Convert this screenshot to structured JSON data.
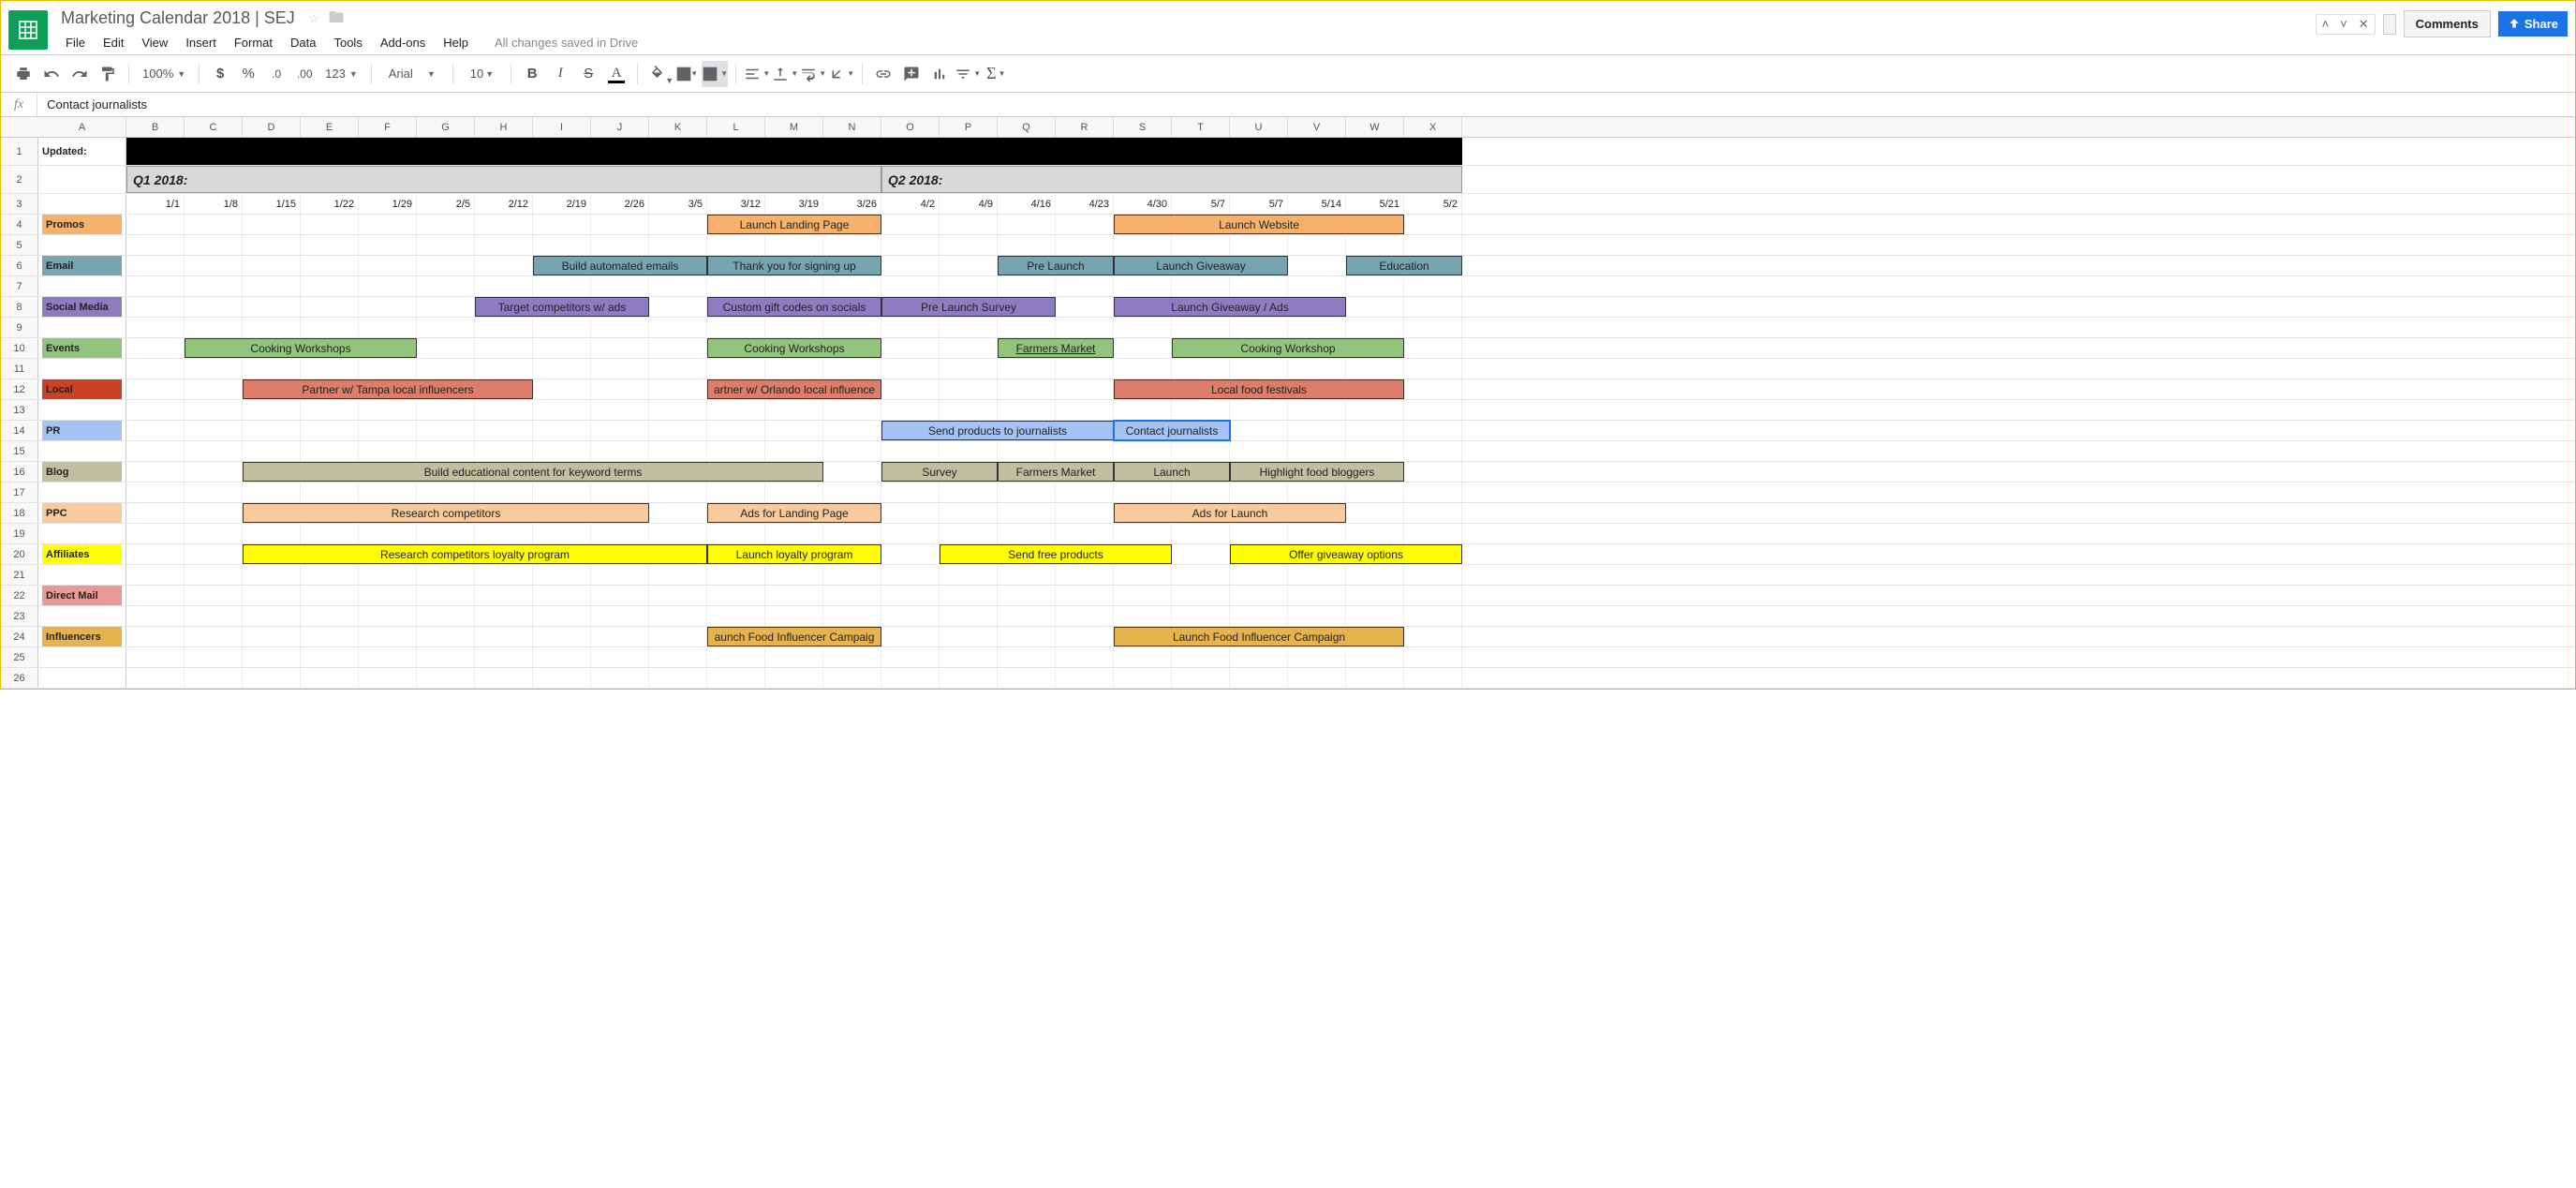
{
  "doc": {
    "title": "Marketing Calendar 2018 | SEJ",
    "save_status": "All changes saved in Drive"
  },
  "menu": {
    "file": "File",
    "edit": "Edit",
    "view": "View",
    "insert": "Insert",
    "format": "Format",
    "data": "Data",
    "tools": "Tools",
    "addons": "Add-ons",
    "help": "Help"
  },
  "buttons": {
    "comments": "Comments",
    "share": "Share"
  },
  "toolbar": {
    "zoom": "100%",
    "font": "Arial",
    "size": "10",
    "morefmt": "123"
  },
  "fx": {
    "value": "Contact journalists"
  },
  "cols": [
    "A",
    "B",
    "C",
    "D",
    "E",
    "F",
    "G",
    "H",
    "I",
    "J",
    "K",
    "L",
    "M",
    "N",
    "O",
    "P",
    "Q",
    "R",
    "S",
    "T",
    "U",
    "V",
    "W",
    "X"
  ],
  "rowA1": "Updated:",
  "quarters": {
    "q1": "Q1 2018:",
    "q2": "Q2 2018:"
  },
  "dates": [
    "1/1",
    "1/8",
    "1/15",
    "1/22",
    "1/29",
    "2/5",
    "2/12",
    "2/19",
    "2/26",
    "3/5",
    "3/12",
    "3/19",
    "3/26",
    "4/2",
    "4/9",
    "4/16",
    "4/23",
    "4/30",
    "5/7",
    "5/7",
    "5/14",
    "5/21",
    "5/2"
  ],
  "cat": {
    "promos": "Promos",
    "email": "Email",
    "social": "Social Media",
    "events": "Events",
    "local": "Local",
    "pr": "PR",
    "blog": "Blog",
    "ppc": "PPC",
    "aff": "Affiliates",
    "dm": "Direct Mail",
    "inf": "Influencers"
  },
  "tasks": {
    "promos": [
      {
        "text": "Launch Landing Page",
        "start": 11,
        "span": 3
      },
      {
        "text": "Launch Website",
        "start": 18,
        "span": 5
      }
    ],
    "email": [
      {
        "text": "Build automated emails",
        "start": 8,
        "span": 3
      },
      {
        "text": "Thank you for signing up",
        "start": 11,
        "span": 3
      },
      {
        "text": "Pre Launch",
        "start": 16,
        "span": 2
      },
      {
        "text": "Launch Giveaway",
        "start": 18,
        "span": 3
      },
      {
        "text": "Education",
        "start": 22,
        "span": 2
      }
    ],
    "social": [
      {
        "text": "Target competitors w/ ads",
        "start": 7,
        "span": 3
      },
      {
        "text": "Custom gift codes on socials",
        "start": 11,
        "span": 3
      },
      {
        "text": "Pre Launch Survey",
        "start": 14,
        "span": 3
      },
      {
        "text": "Launch Giveaway / Ads",
        "start": 18,
        "span": 4
      }
    ],
    "events": [
      {
        "text": "Cooking Workshops",
        "start": 2,
        "span": 4
      },
      {
        "text": "Cooking Workshops",
        "start": 11,
        "span": 3
      },
      {
        "text": "Farmers Market",
        "start": 16,
        "span": 2,
        "underline": true
      },
      {
        "text": "Cooking Workshop",
        "start": 19,
        "span": 4
      }
    ],
    "local": [
      {
        "text": "Partner w/ Tampa local influencers",
        "start": 3,
        "span": 5
      },
      {
        "text": "artner w/ Orlando local influence",
        "start": 11,
        "span": 3
      },
      {
        "text": "Local food festivals",
        "start": 18,
        "span": 5
      }
    ],
    "pr": [
      {
        "text": "Send products to journalists",
        "start": 14,
        "span": 4
      },
      {
        "text": "Contact journalists",
        "start": 18,
        "span": 2,
        "selected": true
      }
    ],
    "blog": [
      {
        "text": "Build educational content for keyword terms",
        "start": 3,
        "span": 10
      },
      {
        "text": "Survey",
        "start": 14,
        "span": 2
      },
      {
        "text": "Farmers Market",
        "start": 16,
        "span": 2
      },
      {
        "text": "Launch",
        "start": 18,
        "span": 2
      },
      {
        "text": "Highlight food bloggers",
        "start": 20,
        "span": 3
      }
    ],
    "ppc": [
      {
        "text": "Research competitors",
        "start": 3,
        "span": 7
      },
      {
        "text": "Ads for Landing Page",
        "start": 11,
        "span": 3
      },
      {
        "text": "Ads for Launch",
        "start": 18,
        "span": 4
      }
    ],
    "aff": [
      {
        "text": "Research competitors loyalty program",
        "start": 3,
        "span": 8
      },
      {
        "text": "Launch loyalty program",
        "start": 11,
        "span": 3
      },
      {
        "text": "Send free products",
        "start": 15,
        "span": 4
      },
      {
        "text": "Offer giveaway options",
        "start": 20,
        "span": 4
      }
    ],
    "inf": [
      {
        "text": "aunch Food Influencer Campaig",
        "start": 11,
        "span": 3
      },
      {
        "text": "Launch Food Influencer Campaign",
        "start": 18,
        "span": 5
      }
    ]
  },
  "colWidths": {
    "A": 94,
    "other": 62
  }
}
